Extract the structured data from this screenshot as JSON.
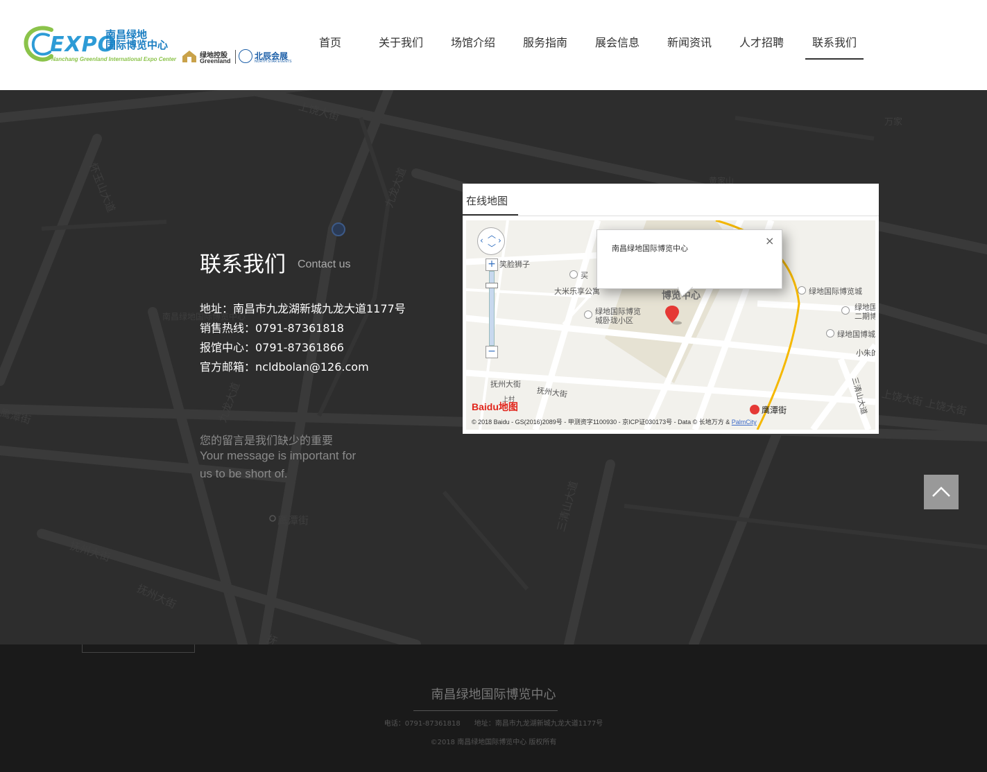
{
  "header": {
    "logo": {
      "expo_text": "EXPO",
      "cn_name_line1": "南昌绿地",
      "cn_name_line2": "国际博览中心",
      "en_name": "Nanchang Greenland International Expo Center",
      "greenland_cn": "绿地控股",
      "greenland_en": "Greenland",
      "northstar_cn": "北辰会展",
      "northstar_en": "NORTH STAR EVENTS"
    },
    "nav": [
      {
        "label": "首页"
      },
      {
        "label": "关于我们"
      },
      {
        "label": "场馆介绍"
      },
      {
        "label": "服务指南"
      },
      {
        "label": "展会信息"
      },
      {
        "label": "新闻资讯"
      },
      {
        "label": "人才招聘"
      },
      {
        "label": "联系我们",
        "active": true
      }
    ]
  },
  "background_map": {
    "labels": [
      "九龙大道",
      "上饶大街",
      "怀玉山大道",
      "南昌绿地国际博览中心",
      "鹰潭街",
      "九龙大道",
      "抚州大街",
      "抚州大街",
      "鹰潭街",
      "三清山大道",
      "上饶大街 上饶大街",
      "万家",
      "黄家山",
      "抚"
    ]
  },
  "contact": {
    "title": "联系我们",
    "subtitle": "Contact us",
    "address": "地址：南昌市九龙湖新城九龙大道1177号",
    "hotline": "销售热线：0791-87361818",
    "booking": "报馆中心：0791-87361866",
    "email": "官方邮箱：ncldbolan@126.com",
    "message_cn": "您的留言是我们缺少的重要",
    "message_en_1": "Your message is important for",
    "message_en_2": "us to be short of."
  },
  "map": {
    "tab_label": "在线地图",
    "popup_text": "南昌绿地国际博览中心",
    "popup_close": "×",
    "labels": [
      "笑脸狮子",
      "买",
      "大米乐享公寓",
      "博览中心",
      "绿地国际博览",
      "城卧珑小区",
      "绿地国际博览城",
      "绿地国",
      "二期博",
      "绿地国博城",
      "小朱的",
      "抚州大街",
      "抚州大街",
      "三清山大道",
      "鹰潭街",
      "上村"
    ],
    "baidu_logo": "Baidu地图",
    "copyright_prefix": "© 2018 Baidu - GS(2016)2089号 - 甲测资字1100930 - 京ICP证030173号 - Data © 长地万方 & ",
    "copyright_link": "PalmCity",
    "zoom_in": "+",
    "zoom_out": "−"
  },
  "footer": {
    "title": "南昌绿地国际博览中心",
    "contact": "电话：0791-87361818　　地址：南昌市九龙湖新城九龙大道1177号",
    "copyright": "©2018 南昌绿地国际博览中心 版权所有"
  },
  "colors": {
    "accent_blue": "#2d9bd6",
    "logo_green": "#8bc34a",
    "map_pin": "#e53935",
    "road_yellow": "#f5b800"
  }
}
